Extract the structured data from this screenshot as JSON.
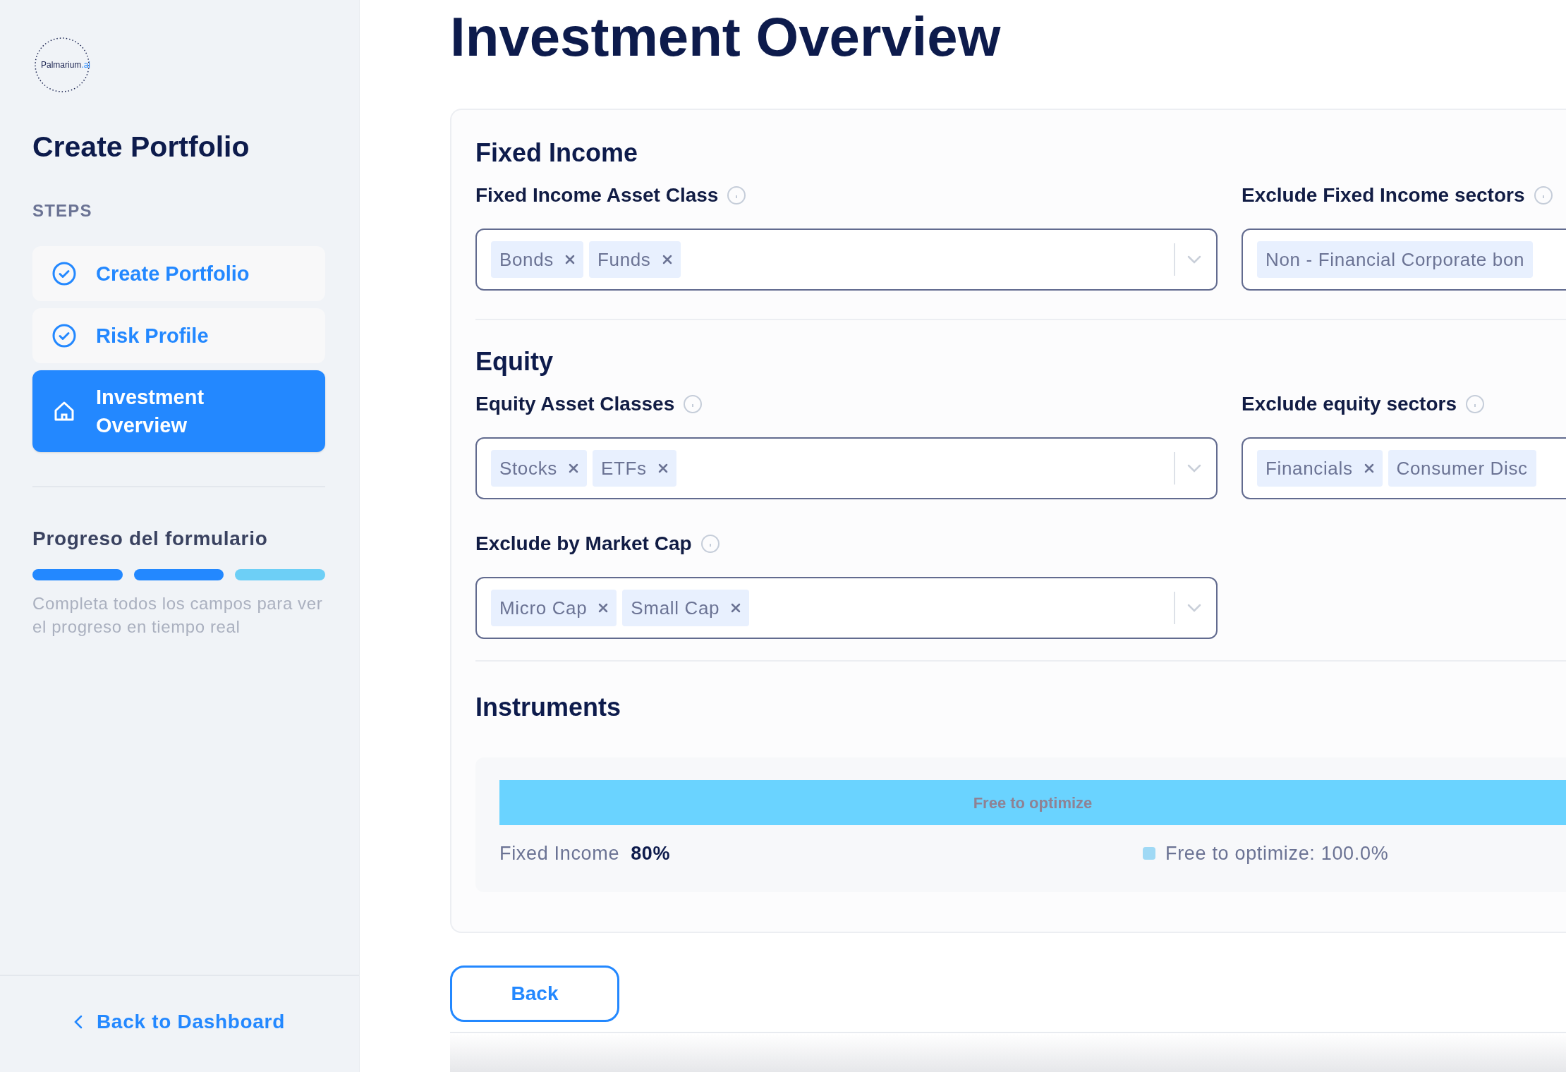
{
  "sidebar": {
    "logo": {
      "name": "Palmarium",
      "suffix": ".ai"
    },
    "title": "Create Portfolio",
    "steps_label": "STEPS",
    "steps": [
      {
        "label": "Create Portfolio",
        "kind": "check",
        "selected": false
      },
      {
        "label": "Risk Profile",
        "kind": "check",
        "selected": false
      },
      {
        "label": "Investment Overview",
        "kind": "home",
        "selected": true
      }
    ],
    "progress": {
      "title": "Progreso del formulario",
      "segments": [
        {
          "completed": true
        },
        {
          "completed": true
        },
        {
          "completed": false
        }
      ],
      "hint": "Completa todos los campos para ver el progreso en tiempo real"
    },
    "back_link": "Back to Dashboard"
  },
  "page_title": "Investment Overview",
  "sections": [
    {
      "title": "Fixed Income",
      "fields": [
        {
          "label": "Fixed Income Asset Class",
          "info": true,
          "dropdown": true,
          "chips": [
            {
              "label": "Bonds",
              "removable": true
            },
            {
              "label": "Funds",
              "removable": true
            }
          ]
        },
        {
          "label": "Exclude Fixed Income sectors",
          "info": true,
          "dropdown": false,
          "chips": [
            {
              "label": "Non - Financial Corporate bon",
              "removable": false
            }
          ]
        }
      ]
    },
    {
      "title": "Equity",
      "fields": [
        {
          "label": "Equity Asset Classes",
          "info": true,
          "dropdown": true,
          "chips": [
            {
              "label": "Stocks",
              "removable": true
            },
            {
              "label": "ETFs",
              "removable": true
            }
          ]
        },
        {
          "label": "Exclude equity sectors",
          "info": true,
          "dropdown": false,
          "chips": [
            {
              "label": "Financials",
              "removable": true
            },
            {
              "label": "Consumer Disc",
              "removable": false
            }
          ]
        },
        {
          "label": "Exclude by Market Cap",
          "info": true,
          "dropdown": true,
          "chips": [
            {
              "label": "Micro Cap",
              "removable": true
            },
            {
              "label": "Small Cap",
              "removable": true
            }
          ]
        }
      ]
    }
  ],
  "instruments": {
    "title": "Instruments",
    "bar": [
      {
        "label": "Free to optimize",
        "level": 1.0
      }
    ],
    "legend": [
      {
        "kind": "value",
        "label": "Fixed Income",
        "value": "80%"
      },
      {
        "kind": "swatch",
        "label": "Free to optimize: 100.0%"
      }
    ]
  },
  "back_button": "Back"
}
